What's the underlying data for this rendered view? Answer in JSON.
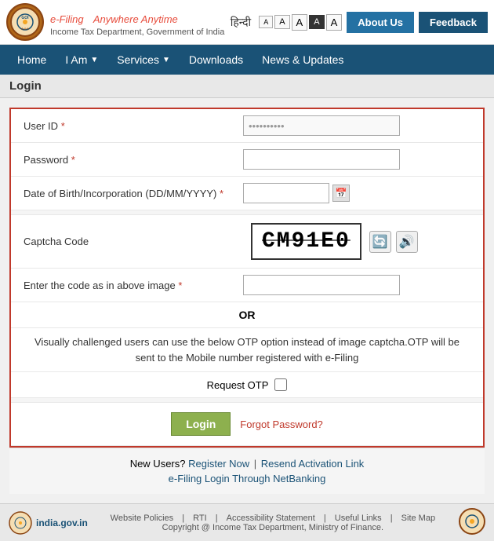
{
  "header": {
    "logo_text": "GOI",
    "brand_title": "e-Filing",
    "brand_subtitle": "Anywhere Anytime",
    "brand_dept": "Income Tax Department, Government of India",
    "lang_hindi": "हिन्दी",
    "font_controls": [
      "A",
      "A",
      "A",
      "A",
      "A"
    ],
    "btn_about": "About Us",
    "btn_feedback": "Feedback"
  },
  "nav": {
    "items": [
      {
        "label": "Home",
        "has_dropdown": false
      },
      {
        "label": "I Am",
        "has_dropdown": true
      },
      {
        "label": "Services",
        "has_dropdown": true
      },
      {
        "label": "Downloads",
        "has_dropdown": false
      },
      {
        "label": "News & Updates",
        "has_dropdown": false
      }
    ]
  },
  "page": {
    "title": "Login"
  },
  "login_form": {
    "user_id_label": "User ID",
    "user_id_placeholder": "",
    "user_id_prefilled": "••••••••••",
    "password_label": "Password",
    "password_placeholder": "",
    "dob_label": "Date of Birth/Incorporation (DD/MM/YYYY)",
    "captcha_label": "Captcha Code",
    "captcha_text": "CM91E0",
    "captcha_enter_label": "Enter the code as in above image",
    "or_text": "OR",
    "otp_message": "Visually challenged users can use the below OTP option instead of image captcha.OTP will be sent to the Mobile number registered with e-Filing",
    "request_otp_label": "Request OTP",
    "btn_login": "Login",
    "forgot_password": "Forgot Password?"
  },
  "footer": {
    "new_users_text": "New Users?",
    "register_link": "Register Now",
    "resend_link": "Resend Activation Link",
    "netbanking_link": "e-Filing Login Through NetBanking"
  },
  "bottom_bar": {
    "india_gov": "india.gov.in",
    "links": [
      "Website Policies",
      "RTI",
      "Accessibility Statement",
      "Useful Links",
      "Site Map"
    ],
    "copyright": "Copyright @ Income Tax Department, Ministry of Finance."
  }
}
